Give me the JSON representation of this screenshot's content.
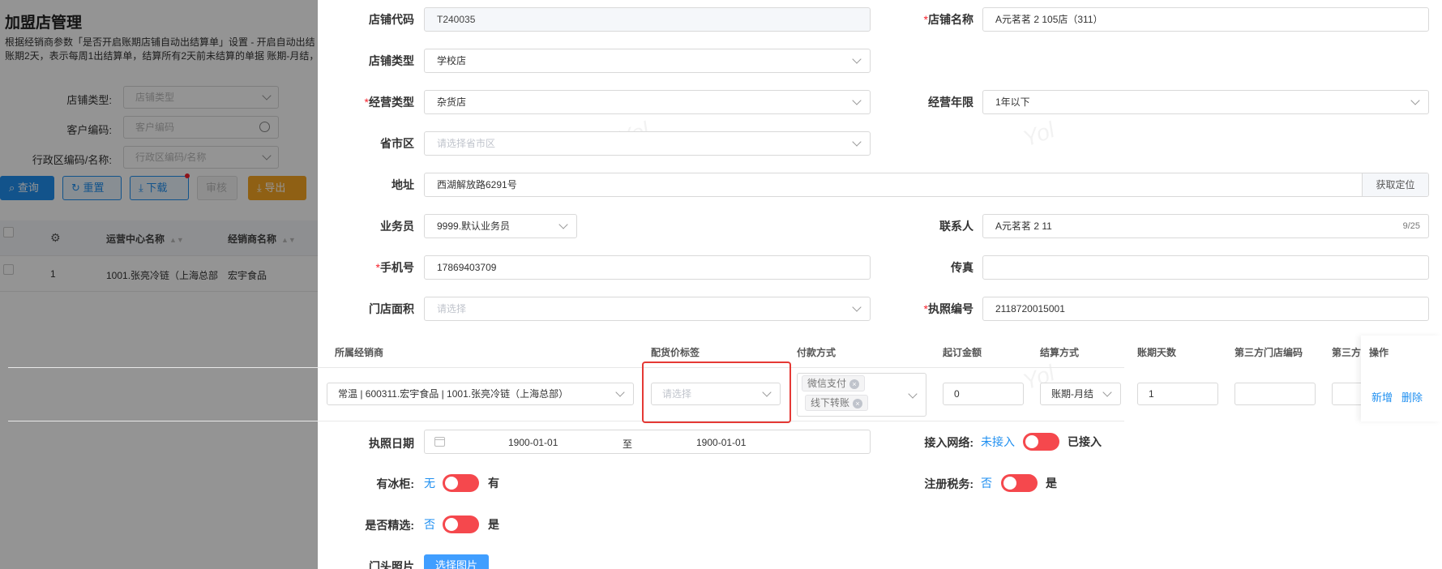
{
  "background": {
    "title": "加盟店管理",
    "desc_line1": "根据经销商参数「是否开启账期店铺自动出结算单」设置 - 开启自动出结",
    "desc_line2": "账期2天，表示每周1出结算单，结算所有2天前未结算的单据 账期-月结，",
    "filters": [
      {
        "label": "店铺类型:",
        "placeholder": "店铺类型"
      },
      {
        "label": "客户编码:",
        "placeholder": "客户编码"
      },
      {
        "label": "行政区编码/名称:",
        "placeholder": "行政区编码/名称"
      }
    ],
    "buttons": {
      "query": "查询",
      "reset": "重置",
      "download": "下载",
      "audit": "审核",
      "export": "导出"
    },
    "table": {
      "headers": [
        "运营中心名称",
        "经销商名称"
      ],
      "row": {
        "index": "1",
        "center": "1001.张亮冷链（上海总部",
        "dealer": "宏宇食品"
      }
    }
  },
  "form": {
    "store_code": {
      "label": "店铺代码",
      "value": "T240035"
    },
    "store_name": {
      "label": "店铺名称",
      "value": "A元茗茗 2 105店（311）"
    },
    "store_type": {
      "label": "店铺类型",
      "value": "学校店"
    },
    "biz_type": {
      "label": "经营类型",
      "value": "杂货店"
    },
    "biz_years": {
      "label": "经营年限",
      "value": "1年以下"
    },
    "region": {
      "label": "省市区",
      "placeholder": "请选择省市区"
    },
    "address": {
      "label": "地址",
      "value": "西湖解放路6291号",
      "button": "获取定位"
    },
    "salesman": {
      "label": "业务员",
      "value": "9999.默认业务员"
    },
    "contact": {
      "label": "联系人",
      "value": "A元茗茗 2 11",
      "count": "9/25"
    },
    "phone": {
      "label": "手机号",
      "value": "17869403709"
    },
    "fax": {
      "label": "传真",
      "value": ""
    },
    "area": {
      "label": "门店面积",
      "placeholder": "请选择"
    },
    "license_no": {
      "label": "执照编号",
      "value": "2118720015001"
    },
    "license_date": {
      "label": "执照日期",
      "start": "1900-01-01",
      "sep": "至",
      "end": "1900-01-01"
    },
    "network": {
      "label": "接入网络:",
      "off": "未接入",
      "on": "已接入"
    },
    "freezer": {
      "label": "有冰柜:",
      "off": "无",
      "on": "有"
    },
    "tax": {
      "label": "注册税务:",
      "off": "否",
      "on": "是"
    },
    "select": {
      "label": "是否精选:",
      "off": "否",
      "on": "是"
    },
    "photo": {
      "label": "门头照片",
      "button": "选择图片"
    }
  },
  "dealer_table": {
    "headers": [
      "所属经销商",
      "配货价标签",
      "付款方式",
      "起订金额",
      "结算方式",
      "账期天数",
      "第三方门店编码",
      "第三方",
      "操作"
    ],
    "row": {
      "dealer": "常温 | 600311.宏宇食品 | 1001.张亮冷链（上海总部）",
      "price_tag_placeholder": "请选择",
      "payments": [
        "微信支付",
        "线下转账"
      ],
      "min_amount": "0",
      "settlement": "账期-月结",
      "days": "1",
      "third_code": "",
      "add": "新增",
      "delete": "删除"
    }
  },
  "watermark": "Yol"
}
